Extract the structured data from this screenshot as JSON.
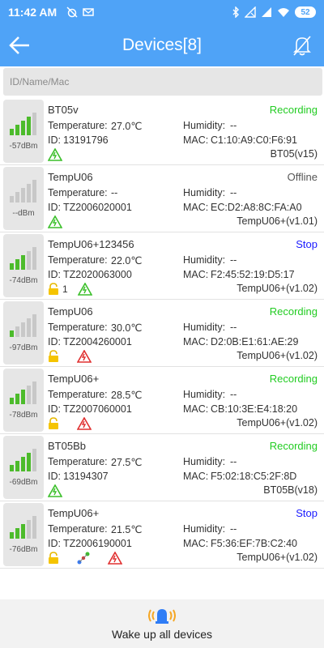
{
  "status_bar": {
    "time": "11:42 AM",
    "battery": "52"
  },
  "header": {
    "title": "Devices[8]"
  },
  "search": {
    "placeholder": "ID/Name/Mac"
  },
  "labels": {
    "temperature": "Temperature:",
    "humidity": "Humidity:",
    "id": "ID:",
    "mac": "MAC:"
  },
  "devices": [
    {
      "name": "BT05v",
      "status": "Recording",
      "status_color": "#22cc22",
      "temperature": "27.0℃",
      "humidity": "--",
      "id": "13191796",
      "mac": "C1:10:A9:C0:F6:91",
      "model": "BT05(v15)",
      "dbm": "-57dBm",
      "signal_level": 4,
      "signal_color": "#4cbb2b",
      "icons": [
        "green-warning-icon"
      ]
    },
    {
      "name": "TempU06",
      "status": "Offline",
      "status_color": "#555555",
      "temperature": "--",
      "humidity": "--",
      "id": "TZ2006020001",
      "mac": "EC:D2:A8:8C:FA:A0",
      "model": "TempU06+(v1.01)",
      "dbm": "--dBm",
      "signal_level": 0,
      "signal_color": "#4cbb2b",
      "icons": [
        "green-warning-icon"
      ]
    },
    {
      "name": "TempU06+123456",
      "status": "Stop",
      "status_color": "#1a1aff",
      "temperature": "22.0℃",
      "humidity": "--",
      "id": "TZ2020063000",
      "mac": "F2:45:52:19:D5:17",
      "model": "TempU06+(v1.02)",
      "dbm": "-74dBm",
      "signal_level": 3,
      "signal_color": "#4cbb2b",
      "icons": [
        "lock-icon",
        "green-warning-icon"
      ],
      "lock_count": "1"
    },
    {
      "name": "TempU06",
      "status": "Recording",
      "status_color": "#22cc22",
      "temperature": "30.0℃",
      "humidity": "--",
      "id": "TZ2004260001",
      "mac": "D2:0B:E1:61:AE:29",
      "model": "TempU06+(v1.02)",
      "dbm": "-97dBm",
      "signal_level": 1,
      "signal_color": "#4cbb2b",
      "icons": [
        "lock-icon",
        "red-warning-icon"
      ]
    },
    {
      "name": "TempU06+",
      "status": "Recording",
      "status_color": "#22cc22",
      "temperature": "28.5℃",
      "humidity": "--",
      "id": "TZ2007060001",
      "mac": "CB:10:3E:E4:18:20",
      "model": "TempU06+(v1.02)",
      "dbm": "-78dBm",
      "signal_level": 3,
      "signal_color": "#4cbb2b",
      "icons": [
        "lock-icon",
        "red-warning-icon"
      ]
    },
    {
      "name": "BT05Bb",
      "status": "Recording",
      "status_color": "#22cc22",
      "temperature": "27.5℃",
      "humidity": "--",
      "id": "13194307",
      "mac": "F5:02:18:C5:2F:8D",
      "model": "BT05B(v18)",
      "dbm": "-69dBm",
      "signal_level": 4,
      "signal_color": "#4cbb2b",
      "icons": [
        "green-warning-icon"
      ]
    },
    {
      "name": "TempU06+",
      "status": "Stop",
      "status_color": "#1a1aff",
      "temperature": "21.5℃",
      "humidity": "--",
      "id": "TZ2006190001",
      "mac": "F5:36:EF:7B:C2:40",
      "model": "TempU06+(v1.02)",
      "dbm": "-76dBm",
      "signal_level": 3,
      "signal_color": "#4cbb2b",
      "icons": [
        "lock-icon",
        "connect-icon",
        "red-warning-icon"
      ]
    }
  ],
  "footer": {
    "wake_label": "Wake up all devices"
  }
}
